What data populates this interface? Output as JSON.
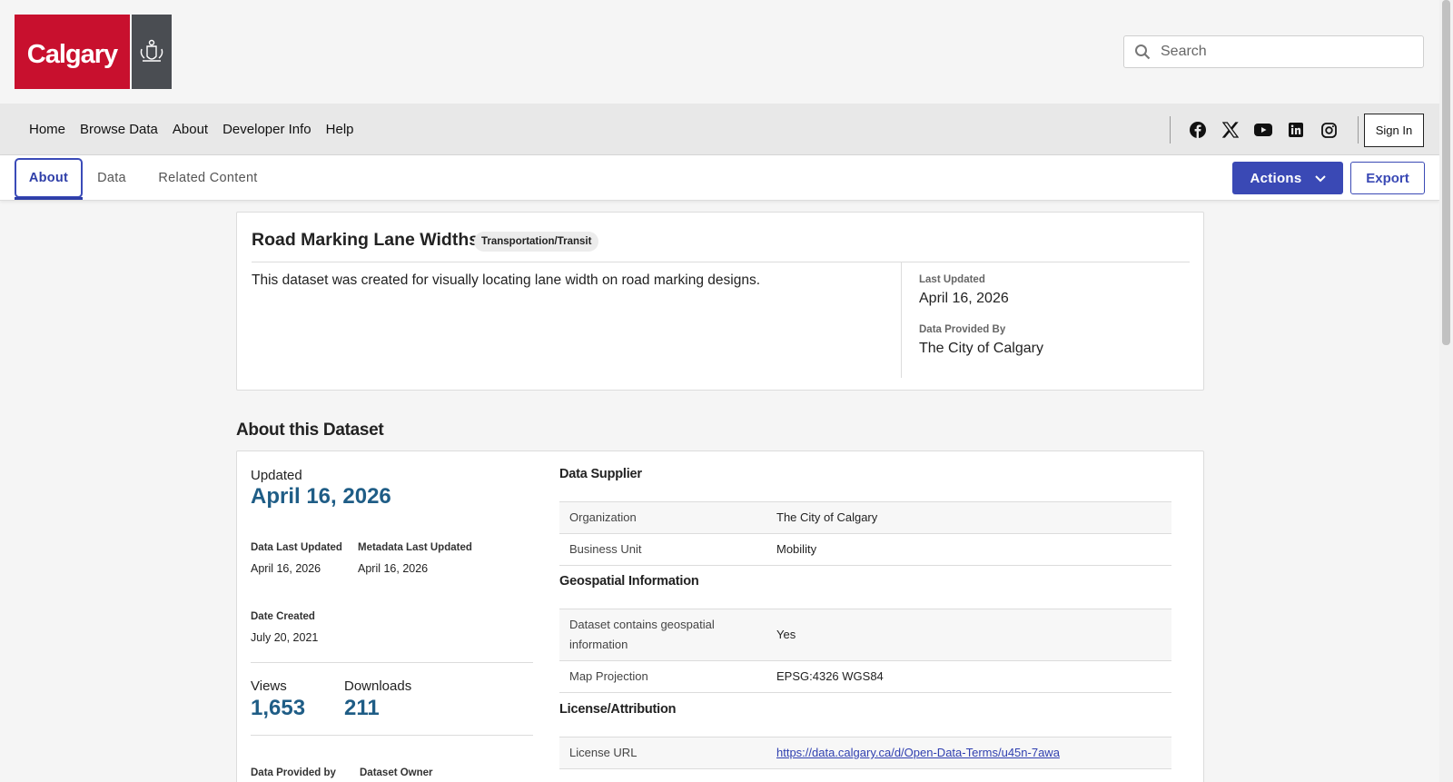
{
  "header": {
    "logo_text": "Calgary",
    "search_placeholder": "Search"
  },
  "nav": {
    "links": [
      "Home",
      "Browse Data",
      "About",
      "Developer Info",
      "Help"
    ],
    "social_icons": [
      "facebook-icon",
      "x-icon",
      "youtube-icon",
      "linkedin-icon",
      "instagram-icon"
    ],
    "sign_in": "Sign In"
  },
  "tabs": {
    "items": [
      "About",
      "Data",
      "Related Content"
    ],
    "active": "About",
    "actions": "Actions",
    "export": "Export"
  },
  "summary": {
    "title": "Road Marking Lane Widths",
    "category": "Transportation/Transit",
    "description": "This dataset was created for visually locating lane width on road marking designs.",
    "last_updated_label": "Last Updated",
    "last_updated": "April 16, 2026",
    "provided_by_label": "Data Provided By",
    "provided_by": "The City of Calgary"
  },
  "about": {
    "section_title": "About this Dataset",
    "updated_label": "Updated",
    "updated": "April 16, 2026",
    "data_last_updated_label": "Data Last Updated",
    "data_last_updated": "April 16, 2026",
    "metadata_last_updated_label": "Metadata Last Updated",
    "metadata_last_updated": "April 16, 2026",
    "date_created_label": "Date Created",
    "date_created": "July 20, 2021",
    "views_label": "Views",
    "views": "1,653",
    "downloads_label": "Downloads",
    "downloads": "211",
    "data_provided_by_label": "Data Provided by",
    "dataset_owner_label": "Dataset Owner"
  },
  "data_supplier": {
    "title": "Data Supplier",
    "rows": [
      {
        "key": "Organization",
        "value": "The City of Calgary"
      },
      {
        "key": "Business Unit",
        "value": "Mobility"
      }
    ]
  },
  "geospatial": {
    "title": "Geospatial Information",
    "rows": [
      {
        "key": "Dataset contains geospatial information",
        "value": "Yes"
      },
      {
        "key": "Map Projection",
        "value": "EPSG:4326 WGS84"
      }
    ]
  },
  "license": {
    "title": "License/Attribution",
    "rows": [
      {
        "key": "License URL",
        "value": "https://data.calgary.ca/d/Open-Data-Terms/u45n-7awa"
      }
    ]
  },
  "colors": {
    "brand_red": "#c8102e",
    "accent_blue": "#3a49b5",
    "stat_blue": "#1f5d86"
  }
}
